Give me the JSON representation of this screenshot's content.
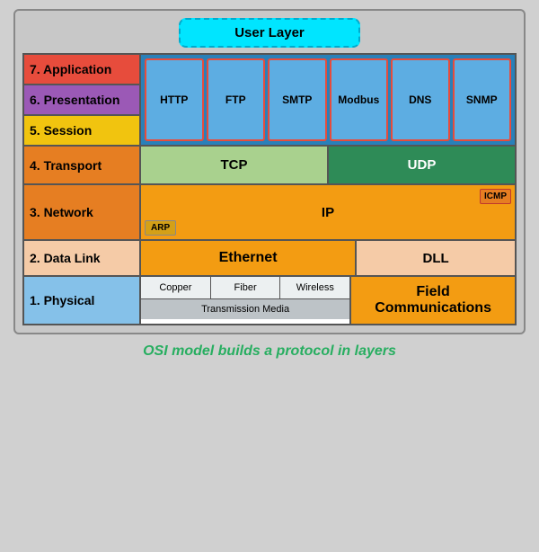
{
  "title": "OSI model builds a protocol in layers",
  "userLayer": "User Layer",
  "layers": {
    "application": "7. Application",
    "presentation": "6. Presentation",
    "session": "5. Session",
    "transport": "4. Transport",
    "network": "3. Network",
    "datalink": "2. Data Link",
    "physical": "1. Physical"
  },
  "protocols": {
    "columns": [
      "HTTP",
      "FTP",
      "SMTP",
      "Modbus",
      "DNS",
      "SNMP"
    ],
    "tcp": "TCP",
    "udp": "UDP",
    "ip": "IP",
    "icmp": "ICMP",
    "arp": "ARP",
    "ethernet": "Ethernet",
    "dll": "DLL",
    "media": [
      "Copper",
      "Fiber",
      "Wireless"
    ],
    "transmissionMedia": "Transmission Media",
    "fieldComm": "Field Communications"
  },
  "caption": "OSI model builds a protocol in layers"
}
